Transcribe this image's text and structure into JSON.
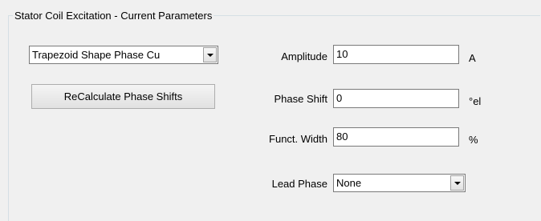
{
  "group": {
    "title": "Stator Coil Excitation - Current Parameters"
  },
  "shape_select": {
    "value": "Trapezoid Shape Phase Cu"
  },
  "recalculate_button": {
    "label": "ReCalculate Phase Shifts"
  },
  "fields": {
    "amplitude": {
      "label": "Amplitude",
      "value": "10",
      "unit": "A"
    },
    "phase_shift": {
      "label": "Phase Shift",
      "value": "0",
      "unit": "°el"
    },
    "funct_width": {
      "label": "Funct. Width",
      "value": "80",
      "unit": "%"
    }
  },
  "lead_phase": {
    "label": "Lead Phase",
    "value": "None"
  }
}
